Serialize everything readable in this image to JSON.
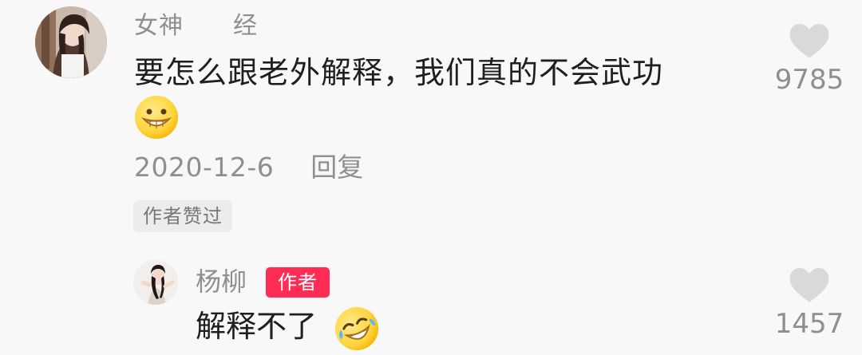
{
  "comments": {
    "main": {
      "username": "女神　　经",
      "text": "要怎么跟老外解释，我们真的不会武功",
      "date": "2020-12-6",
      "reply_label": "回复",
      "author_liked_label": "作者赞过",
      "like_count": "9785",
      "emoji_name": "grinning-face-icon",
      "like_icon": "heart-icon"
    },
    "reply": {
      "username": "杨柳",
      "author_badge": "作者",
      "text": "解释不了",
      "emoji_name": "rolling-on-the-floor-laughing-icon",
      "like_count": "1457",
      "like_icon": "heart-icon"
    }
  },
  "colors": {
    "background": "#f8f8f8",
    "primary_text": "#1f1f1f",
    "secondary_text": "#8f8f8f",
    "author_badge": "#ff2d55",
    "liked_badge_bg": "#ececec"
  }
}
